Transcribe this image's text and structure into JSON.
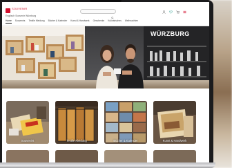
{
  "site": {
    "logo_text": "SOUVENIR",
    "tagline": "Englisch Souvenir Würzburg"
  },
  "search": {
    "placeholder": ""
  },
  "nav": {
    "items": [
      {
        "label": "Home",
        "active": true
      },
      {
        "label": "Souvenirs",
        "active": false
      },
      {
        "label": "Textile Kleidung",
        "active": false
      },
      {
        "label": "Bücher & Kalender",
        "active": false
      },
      {
        "label": "Kunst & Handwerk",
        "active": false
      },
      {
        "label": "Geschenke",
        "active": false
      },
      {
        "label": "Kulinarisches",
        "active": false
      },
      {
        "label": "Weihnachten",
        "active": false
      }
    ]
  },
  "hero": {
    "sign_text": "WÜRZBURG"
  },
  "categories": [
    {
      "label": "Souvenirs"
    },
    {
      "label": "Textile Kleidung"
    },
    {
      "label": "Bücher & Kalender"
    },
    {
      "label": "Kunst & Handwerk"
    }
  ],
  "colors": {
    "brand": "#d3112f",
    "bezel": "#1b1b1d"
  },
  "icons": [
    "search-icon",
    "user-icon",
    "heart-icon",
    "cart-icon",
    "menu-icon"
  ]
}
